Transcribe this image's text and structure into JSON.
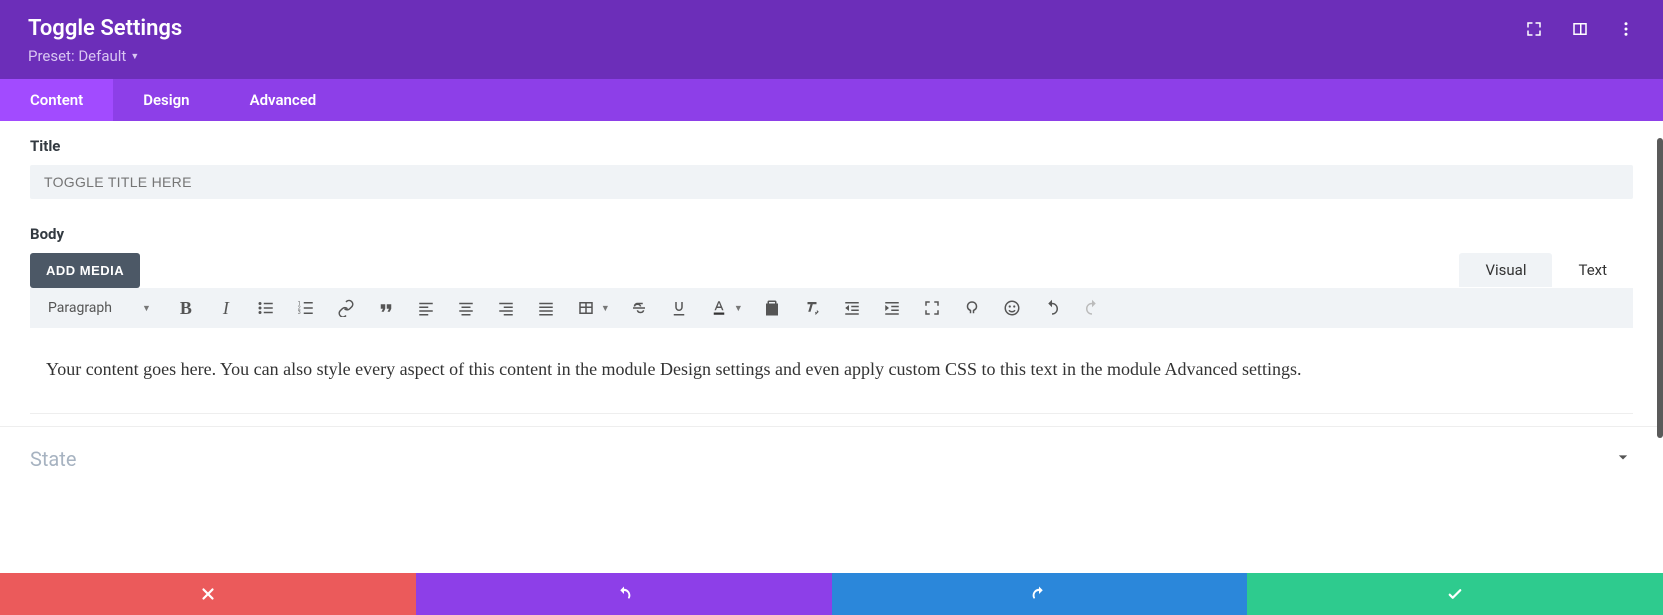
{
  "header": {
    "title": "Toggle Settings",
    "preset_label": "Preset: Default",
    "icons": {
      "resize": "resize-icon",
      "panel": "panel-icon",
      "more": "more-vertical-icon"
    }
  },
  "tabs": [
    {
      "label": "Content",
      "active": true
    },
    {
      "label": "Design",
      "active": false
    },
    {
      "label": "Advanced",
      "active": false
    }
  ],
  "form": {
    "title_label": "Title",
    "title_placeholder": "TOGGLE TITLE HERE",
    "body_label": "Body",
    "add_media_label": "ADD MEDIA",
    "editor_tabs": {
      "visual": "Visual",
      "text": "Text",
      "active": "visual"
    },
    "format_dropdown": "Paragraph",
    "editor_content": "Your content goes here. You can also style every aspect of this content in the module Design settings and even apply custom CSS to this text in the module Advanced settings."
  },
  "toolbar_icons": [
    "bold",
    "italic",
    "bullet-list",
    "numbered-list",
    "link",
    "blockquote",
    "align-left",
    "align-center",
    "align-right",
    "align-justify",
    "table",
    "strikethrough",
    "underline",
    "text-color",
    "paste",
    "clear-formatting",
    "outdent",
    "indent",
    "fullscreen",
    "special-char",
    "emoji",
    "undo",
    "redo"
  ],
  "sections": {
    "state_label": "State"
  },
  "footer": {
    "cancel": "cancel",
    "undo": "undo",
    "redo": "redo",
    "save": "save"
  },
  "colors": {
    "header": "#6c2eb9",
    "tabs_bg": "#8d3fe8",
    "tab_active": "#a24bff",
    "cancel": "#eb5a5b",
    "undo": "#8d3fe8",
    "redo": "#2b87da",
    "save": "#2ecb8e"
  }
}
